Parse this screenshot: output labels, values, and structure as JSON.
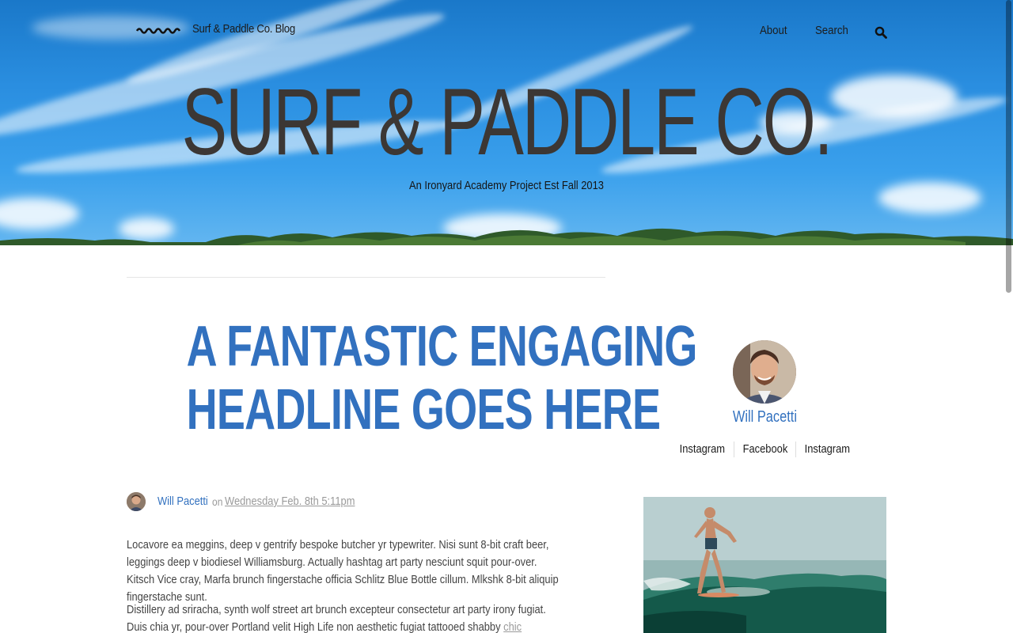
{
  "header": {
    "blog_name": "Surf & Paddle Co. Blog",
    "logo_icon": "wave-logo-icon",
    "nav": {
      "about": "About",
      "search": "Search"
    },
    "search_icon": "search-icon"
  },
  "hero": {
    "title": "SURF & PADDLE CO.",
    "subtitle": "An Ironyard Academy Project Est Fall 2013"
  },
  "post": {
    "headline_line1": "A FANTASTIC ENGAGING",
    "headline_line2": "HEADLINE GOES HERE",
    "author": "Will Pacetti",
    "on": "on",
    "date": "Wednesday Feb. 8th 5:11pm",
    "paragraph1": "Locavore ea meggins, deep v gentrify bespoke butcher yr typewriter. Nisi sunt 8-bit craft beer, leggings deep v biodiesel Williamsburg. Actually hashtag art party nesciunt squit pour-over. Kitsch Vice cray, Marfa brunch fingerstache officia Schlitz Blue Bottle cillum. Mlkshk 8-bit aliquip fingerstache sunt.",
    "paragraph2_text": "Distillery ad sriracha, synth wolf street art brunch excepteur consectetur art party irony fugiat. Duis chia yr, pour-over Portland velit High Life non aesthetic fugiat tattooed shabby",
    "paragraph2_link": "chic mixtape",
    "paragraph2_end": "."
  },
  "sidebar": {
    "profile_name": "Will Pacetti",
    "social": [
      "Instagram",
      "Facebook",
      "Instagram"
    ]
  },
  "colors": {
    "accent": "#3271bf",
    "hero_title": "#3c3734",
    "sky": "#2a8ee0"
  }
}
